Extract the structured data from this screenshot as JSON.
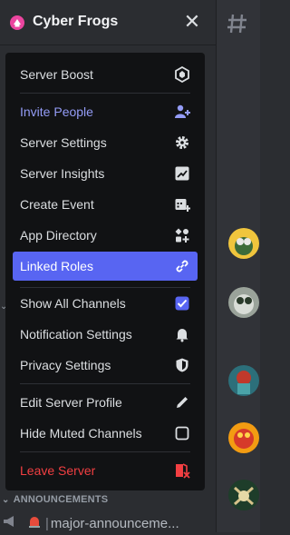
{
  "server": {
    "name": "Cyber Frogs"
  },
  "menu": {
    "server_boost": "Server Boost",
    "invite_people": "Invite People",
    "server_settings": "Server Settings",
    "server_insights": "Server Insights",
    "create_event": "Create Event",
    "app_directory": "App Directory",
    "linked_roles": "Linked Roles",
    "show_all_channels": "Show All Channels",
    "show_all_channels_checked": true,
    "notification_settings": "Notification Settings",
    "privacy_settings": "Privacy Settings",
    "edit_server_profile": "Edit Server Profile",
    "hide_muted_channels": "Hide Muted Channels",
    "hide_muted_channels_checked": false,
    "leave_server": "Leave Server"
  },
  "sidebar": {
    "category": "ANNOUNCEMENTS",
    "channel_name": "major-announceme..."
  },
  "colors": {
    "accent": "#5865f2",
    "invite": "#949cf7",
    "danger": "#f23f42",
    "menu_bg": "#111214"
  }
}
